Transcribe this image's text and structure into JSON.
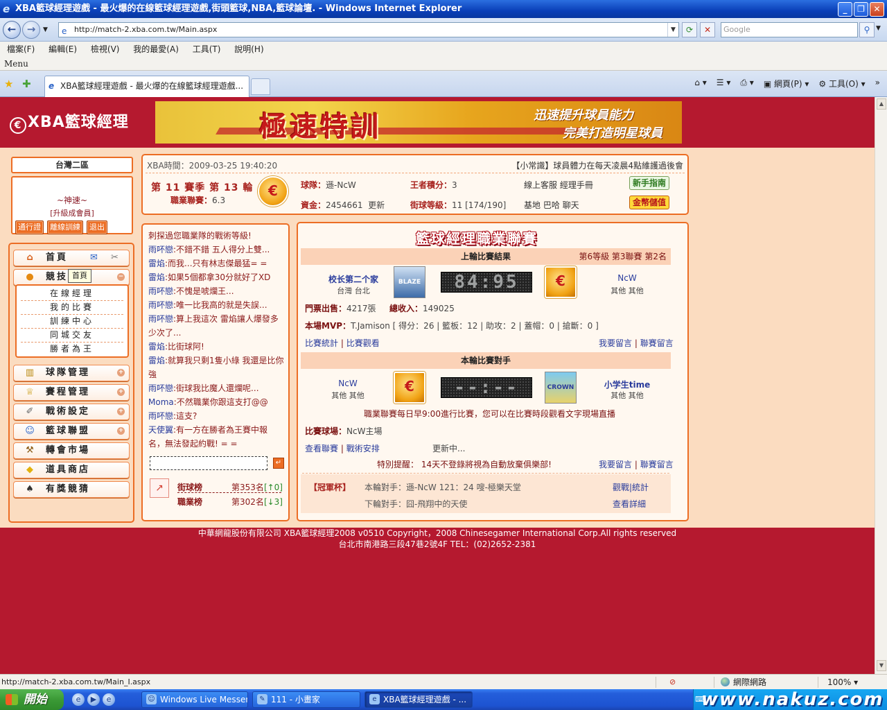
{
  "window": {
    "title": "XBA籃球經理遊戲 - 最火爆的在線籃球經理遊戲,街頭籃球,NBA,籃球論壇. - Windows Internet Explorer",
    "url": "http://match-2.xba.com.tw/Main.aspx",
    "search_placeholder": "Google"
  },
  "menubar": {
    "items": [
      "檔案(F)",
      "編輯(E)",
      "檢視(V)",
      "我的最愛(A)",
      "工具(T)",
      "說明(H)"
    ],
    "label": "Menu"
  },
  "tabbar": {
    "active_tab": "XBA籃球經理遊戲 - 最火爆的在線籃球經理遊戲...",
    "page_menu": "網頁(P)",
    "tools_menu": "工具(O)"
  },
  "header": {
    "logo_text": "XBA籃球經理",
    "banner_main": "極速特訓",
    "banner_line1": "迅速提升球員能力",
    "banner_line2": "完美打造明星球員"
  },
  "left": {
    "server": "台灣二區",
    "user_name": "~神速~",
    "user_tier": "[升級成會員]",
    "buttons": [
      "通行證",
      "離線訓練",
      "退出"
    ],
    "nav": [
      {
        "label": "首頁",
        "icon": "house-icon"
      },
      {
        "label": "競技場",
        "icon": "basketball-icon"
      },
      {
        "label": "球隊管理",
        "icon": "building-icon"
      },
      {
        "label": "賽程管理",
        "icon": "trophy-icon"
      },
      {
        "label": "戰術設定",
        "icon": "tactics-icon"
      },
      {
        "label": "籃球聯盟",
        "icon": "people-icon"
      },
      {
        "label": "轉會市場",
        "icon": "hammer-icon"
      },
      {
        "label": "道具商店",
        "icon": "gold-icon"
      },
      {
        "label": "有獎競猜",
        "icon": "spade-icon"
      }
    ],
    "nav_tooltip": "首頁",
    "submenu": [
      "在線經理",
      "我的比賽",
      "訓練中心",
      "同城交友",
      "勝者為王"
    ]
  },
  "status": {
    "time_label": "XBA時間：",
    "time_value": "2009-03-25 19:40:20",
    "tip": "【小常識】球員體力在每天凌晨4點維護過後會",
    "season_prefix": "第",
    "season_num": "11",
    "season_mid": "賽季  第",
    "round_num": "13",
    "round_suffix": "輪",
    "league_label": "職業聯賽：",
    "league_value": "6.3",
    "team_label": "球隊：",
    "team_value": "遜-NcW",
    "funds_label": "資金：",
    "funds_value": "2454661",
    "funds_update": "更新",
    "king_label": "王者積分：",
    "king_value": "3",
    "level_label": "街球等級：",
    "level_value": "11 [174/190]",
    "links_row1": "線上客服  經理手冊",
    "links_row2": "基地  巴哈  聊天",
    "btn_guide": "新手指南",
    "btn_gold": "金幣儲值"
  },
  "chat": {
    "messages": [
      {
        "who": "",
        "text": "刺探過您職業隊的戰術等級!"
      },
      {
        "who": "雨吥戀",
        "text": ":不錯不錯  五人得分上雙..."
      },
      {
        "who": "雷焰",
        "text": ":而我...只有林志傑最猛= ="
      },
      {
        "who": "雷焰",
        "text": ":如果5個都拿30分就好了XD"
      },
      {
        "who": "雨吥戀",
        "text": ":不愧是唬爛王..."
      },
      {
        "who": "雨吥戀",
        "text": ":唯一比我高的就是失誤..."
      },
      {
        "who": "雨吥戀",
        "text": ":算上我這次  雷焰讓人爆發多少次了..."
      },
      {
        "who": "雷焰",
        "text": ":比街球阿!"
      },
      {
        "who": "雷焰",
        "text": ":就算我只剩1隻小綠  我還是比你強"
      },
      {
        "who": "雨吥戀",
        "text": ":街球我比魔人還爛呢..."
      },
      {
        "who": "Moma",
        "text": ":不然職業你跟這支打@@"
      },
      {
        "who": "雨吥戀",
        "text": ":這支?"
      },
      {
        "who": "天使翼",
        "text": ":有一方在勝者為王賽中報名，無法發起約戰! = ="
      }
    ],
    "send_icon": "enter-icon",
    "rank1_label": "街球榜",
    "rank1_value": "第353名",
    "rank1_delta": "[↑0]",
    "rank2_label": "職業榜",
    "rank2_value": "第302名",
    "rank2_delta": "[↓3]"
  },
  "league": {
    "title": "籃球經理職業聯賽",
    "last_head": "上輪比賽結果",
    "last_meta": "第6等級  第3聯賽  第2名",
    "home_name": "校长第二个家",
    "home_loc": "台灣  台北",
    "away_name": "NcW",
    "away_loc": "其他  其他",
    "home_logo_text": "BLAZE",
    "score": "84:95",
    "tickets_label": "門票出售：",
    "tickets_value": "4217張",
    "income_label": "總收入：",
    "income_value": "149025",
    "mvp_label": "本場MVP：",
    "mvp_value": "T.Jamison [ 得分：26 | 籃板：12 | 助攻：2 | 蓋帽：0 | 搶斷：0 ]",
    "link_stats": "比賽統計",
    "link_watch": "比賽觀看",
    "link_msg": "我要留言",
    "link_board": "聯賽留言",
    "next_head": "本輪比賽對手",
    "next_home_name": "NcW",
    "next_home_loc": "其他  其他",
    "next_away_name": "小学生time",
    "next_away_loc": "其他  其他",
    "next_away_logo_text": "CROWN",
    "next_score": "--:--",
    "schedule_note": "職業聯賽每日早9:00進行比賽，您可以在比賽時段觀看文字現場直播",
    "venue_label": "比賽球場：",
    "venue_value": "NcW主場",
    "link_view_league": "查看聯賽",
    "link_tactics": "戰術安排",
    "updating": "更新中...",
    "reminder": "特別提醒：  14天不登錄將視為自動放棄俱樂部!",
    "cup_label": "【冠軍杯】",
    "cup_this": "本輪對手：遜-NcW 121：24 嗖-極樂天堂",
    "cup_next": "下輪對手：囧-飛翔中的天使",
    "cup_link1": "觀戰|統計",
    "cup_link2": "查看詳細"
  },
  "footer": {
    "line1": "中華網龍股份有限公司  XBA籃球經理2008 v0510    Copyright，2008 Chinesegamer International Corp.All rights reserved",
    "line2": "台北市南港路三段47巷2號4F TEL：(02)2652-2381"
  },
  "statusbar": {
    "link": "http://match-2.xba.com.tw/Main_I.aspx",
    "zone": "網際網路",
    "zoom": "100%"
  },
  "taskbar": {
    "start": "開始",
    "items": [
      "Windows Live Messen...",
      "111 - 小畫家",
      "XBA籃球經理遊戲 - ..."
    ],
    "watermark": "www.nakuz.com"
  }
}
